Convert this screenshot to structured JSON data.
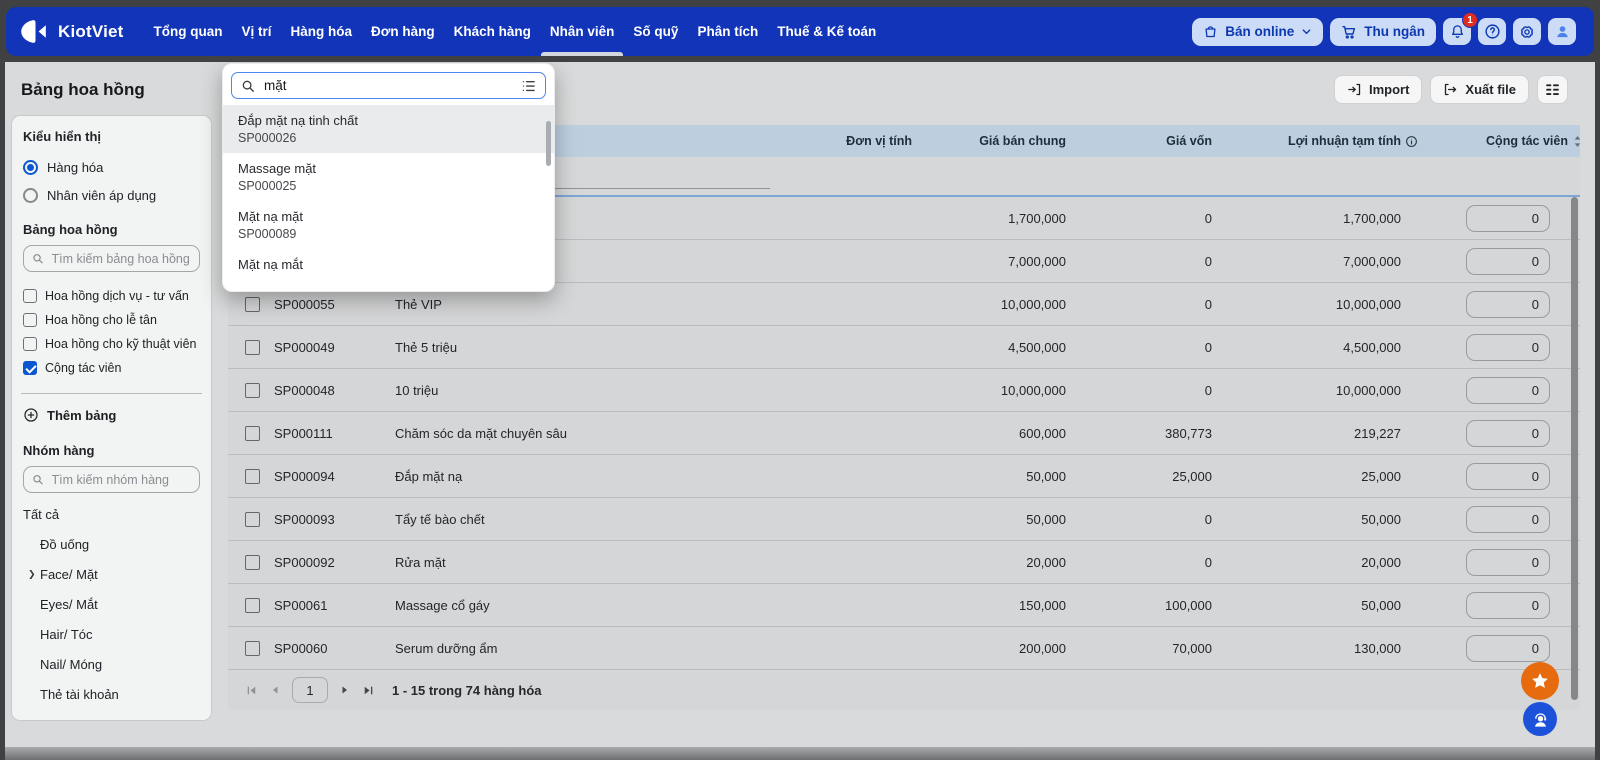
{
  "nav": {
    "brand": "KiotViet",
    "items": [
      {
        "label": "Tổng quan"
      },
      {
        "label": "Vị trí"
      },
      {
        "label": "Hàng hóa"
      },
      {
        "label": "Đơn hàng"
      },
      {
        "label": "Khách hàng"
      },
      {
        "label": "Nhân viên",
        "active": true
      },
      {
        "label": "Số quỹ"
      },
      {
        "label": "Phân tích"
      },
      {
        "label": "Thuế & Kế toán"
      }
    ],
    "actions": {
      "sell_online_label": "Bán online",
      "cashier_label": "Thu ngân",
      "notification_count": "1"
    }
  },
  "page": {
    "title": "Bảng hoa hồng"
  },
  "sidebar": {
    "display_type": {
      "label": "Kiểu hiển thị",
      "options": [
        {
          "label": "Hàng hóa",
          "selected": true
        },
        {
          "label": "Nhân viên áp dụng",
          "selected": false
        }
      ]
    },
    "commission_tables": {
      "label": "Bảng hoa hồng",
      "search_placeholder": "Tìm kiếm bảng hoa hồng",
      "tables": [
        {
          "label": "Hoa hồng dịch vụ - tư vấn",
          "checked": false
        },
        {
          "label": "Hoa hồng cho lễ tân",
          "checked": false
        },
        {
          "label": "Hoa hồng cho kỹ thuật viên",
          "checked": false
        },
        {
          "label": "Cộng tác viên",
          "checked": true
        }
      ],
      "add_label": "Thêm bảng"
    },
    "product_groups": {
      "label": "Nhóm hàng",
      "search_placeholder": "Tìm kiếm nhóm hàng",
      "items": [
        {
          "label": "Tất cả",
          "root": true
        },
        {
          "label": "Đồ uống"
        },
        {
          "label": "Face/ Mặt",
          "chevron": true
        },
        {
          "label": "Eyes/ Mắt"
        },
        {
          "label": "Hair/ Tóc"
        },
        {
          "label": "Nail/ Móng"
        },
        {
          "label": "Thẻ tài khoản"
        }
      ]
    }
  },
  "toolbar": {
    "import_label": "Import",
    "export_label": "Xuất file"
  },
  "search_dropdown": {
    "query": "mặt",
    "results": [
      {
        "name": "Đắp mặt nạ tinh chất",
        "code": "SP000026",
        "highlighted": true
      },
      {
        "name": "Massage mặt",
        "code": "SP000025"
      },
      {
        "name": "Mặt nạ mặt",
        "code": "SP000089"
      },
      {
        "name": "Mặt nạ mắt",
        "code": ""
      }
    ]
  },
  "table": {
    "columns": {
      "unit": "Đơn vị tính",
      "price": "Giá bán chung",
      "cost": "Giá vốn",
      "profit": "Lợi nhuận tạm tính",
      "ctv": "Cộng tác viên"
    },
    "rows": [
      {
        "code": "",
        "name": "",
        "unit": "",
        "price": "1,700,000",
        "cost": "0",
        "profit": "1,700,000",
        "ctv": "0"
      },
      {
        "code": "",
        "name": "",
        "unit": "",
        "price": "7,000,000",
        "cost": "0",
        "profit": "7,000,000",
        "ctv": "0"
      },
      {
        "code": "SP000055",
        "name": "Thẻ VIP",
        "unit": "",
        "price": "10,000,000",
        "cost": "0",
        "profit": "10,000,000",
        "ctv": "0"
      },
      {
        "code": "SP000049",
        "name": "Thẻ 5 triệu",
        "unit": "",
        "price": "4,500,000",
        "cost": "0",
        "profit": "4,500,000",
        "ctv": "0"
      },
      {
        "code": "SP000048",
        "name": "10 triệu",
        "unit": "",
        "price": "10,000,000",
        "cost": "0",
        "profit": "10,000,000",
        "ctv": "0"
      },
      {
        "code": "SP000111",
        "name": "Chăm sóc da mặt chuyên sâu",
        "unit": "",
        "price": "600,000",
        "cost": "380,773",
        "profit": "219,227",
        "ctv": "0"
      },
      {
        "code": "SP000094",
        "name": "Đắp mặt nạ",
        "unit": "",
        "price": "50,000",
        "cost": "25,000",
        "profit": "25,000",
        "ctv": "0"
      },
      {
        "code": "SP000093",
        "name": "Tẩy tế bào chết",
        "unit": "",
        "price": "50,000",
        "cost": "0",
        "profit": "50,000",
        "ctv": "0"
      },
      {
        "code": "SP000092",
        "name": "Rửa mặt",
        "unit": "",
        "price": "20,000",
        "cost": "0",
        "profit": "20,000",
        "ctv": "0"
      },
      {
        "code": "SP00061",
        "name": "Massage cổ gáy",
        "unit": "",
        "price": "150,000",
        "cost": "100,000",
        "profit": "50,000",
        "ctv": "0"
      },
      {
        "code": "SP00060",
        "name": "Serum dưỡng ẩm",
        "unit": "",
        "price": "200,000",
        "cost": "70,000",
        "profit": "130,000",
        "ctv": "0"
      }
    ],
    "pagination": {
      "current_page": "1",
      "summary": "1 - 15 trong 74 hàng hóa"
    }
  },
  "colors": {
    "nav_blue": "#1134b8",
    "accent_blue": "#0b57d0",
    "table_header": "#bdcfdf",
    "badge_red": "#e12b1f",
    "fab_orange": "#e66a0e",
    "fab_blue": "#1c51d9"
  }
}
